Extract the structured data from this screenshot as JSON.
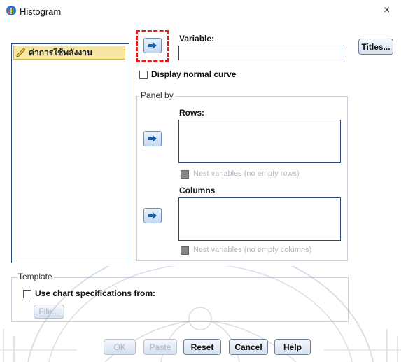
{
  "window": {
    "title": "Histogram",
    "close_glyph": "×"
  },
  "variable_list": {
    "items": [
      {
        "label": "ค่าการใช้พลังงาน",
        "icon": "ruler-pencil-icon"
      }
    ]
  },
  "variable": {
    "label": "Variable:",
    "value": "",
    "move_button_icon": "right-arrow-icon"
  },
  "display_normal_curve": {
    "label": "Display normal curve",
    "checked": false
  },
  "panel_by": {
    "label": "Panel by",
    "rows_label": "Rows:",
    "rows_nest_label": "Nest variables (no empty rows)",
    "columns_label": "Columns",
    "columns_nest_label": "Nest variables (no empty columns)"
  },
  "titles_button": "Titles...",
  "template": {
    "label": "Template",
    "use_chart_spec_label": "Use chart specifications from:",
    "file_button": "File..."
  },
  "footer": {
    "ok": "OK",
    "paste": "Paste",
    "reset": "Reset",
    "cancel": "Cancel",
    "help": "Help"
  },
  "colors": {
    "highlight_dash": "#e02020",
    "arrow_blue": "#1d5fa8",
    "list_item_bg": "#f6e8a4"
  }
}
